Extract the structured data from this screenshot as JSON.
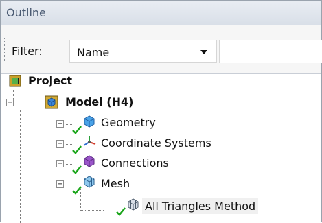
{
  "panel": {
    "title": "Outline"
  },
  "filter": {
    "label": "Filter:",
    "value": "Name"
  },
  "tree": {
    "project": "Project",
    "model": "Model (H4)",
    "children": [
      "Geometry",
      "Coordinate Systems",
      "Connections",
      "Mesh"
    ],
    "mesh_child": "All Triangles Method"
  },
  "colors": {
    "check": "#1aa51a",
    "model_icon": "#2f72c9",
    "project_icon": "#c9a21f"
  }
}
